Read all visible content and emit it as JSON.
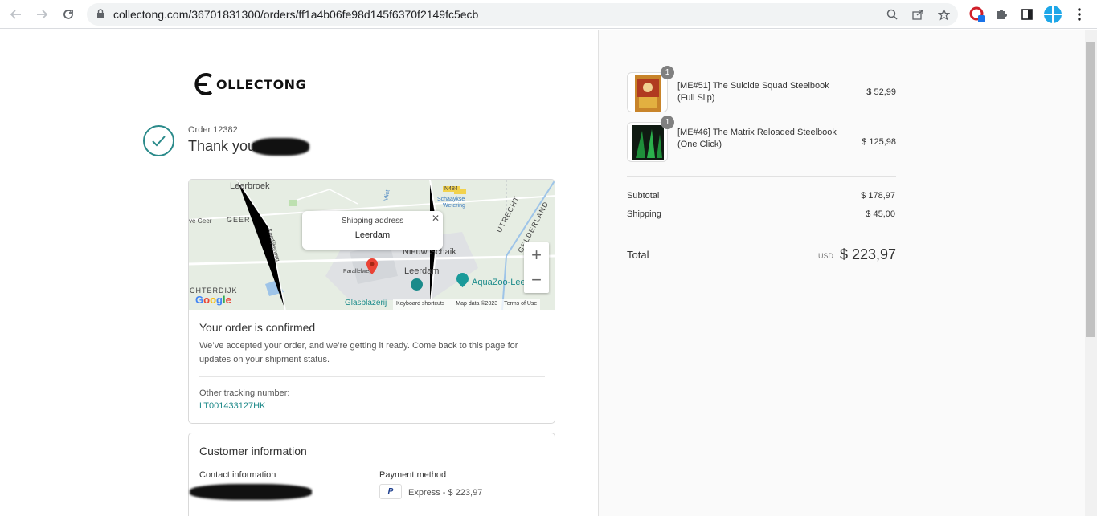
{
  "browser": {
    "url": "collectong.com/36701831300/orders/ff1a4b06fe98d145f6370f2149fc5ecb",
    "icons": [
      "back-icon",
      "forward-icon",
      "reload-icon",
      "lock-icon",
      "zoom-icon",
      "share-icon",
      "star-icon",
      "extension-icon",
      "puzzle-icon",
      "sidepanel-icon",
      "profile-icon",
      "menu-icon"
    ]
  },
  "store": {
    "logo_text": "OLLECTONG"
  },
  "order": {
    "number_label": "Order 12382",
    "thank_you": "Thank you"
  },
  "map": {
    "popup_title": "Shipping address",
    "popup_value": "Leerdam",
    "places": {
      "leerbroek": "Leerbroek",
      "geer": "GEER",
      "ve_geer": "ve Geer",
      "n484": "N484",
      "schaaykse": "Schaaykse",
      "wetering": "Wetering",
      "utrecht": "UTRECHT",
      "gelderland": "GELDERLAND",
      "nieuw_schaik": "Nieuw Schaik",
      "leerdam": "Leerdam",
      "aquazoo": "AquaZoo-Lee",
      "paralle": "Parallelweg",
      "chterdijk": "CHTERDIJK",
      "glasblazerij": "Glasblazerij",
      "koedijk": "Koedijkerweg",
      "vliet": "Vliet"
    },
    "footer": {
      "shortcuts": "Keyboard shortcuts",
      "mapdata": "Map data ©2023",
      "terms": "Terms of Use"
    },
    "google": "Google"
  },
  "confirmation": {
    "title": "Your order is confirmed",
    "text": "We’ve accepted your order, and we’re getting it ready. Come back to this page for updates on your shipment status.",
    "tracking_label": "Other tracking number:",
    "tracking_number": "LT001433127HK"
  },
  "customer": {
    "title": "Customer information",
    "contact_label": "Contact information",
    "payment_label": "Payment method",
    "payment_value": "Express - $ 223,97"
  },
  "summary": {
    "items": [
      {
        "quantity": "1",
        "name": "[ME#51] The Suicide Squad Steelbook (Full Slip)",
        "price": "$ 52,99"
      },
      {
        "quantity": "1",
        "name": "[ME#46] The Matrix Reloaded Steelbook (One Click)",
        "price": "$ 125,98"
      }
    ],
    "subtotal_label": "Subtotal",
    "subtotal": "$ 178,97",
    "shipping_label": "Shipping",
    "shipping": "$ 45,00",
    "total_label": "Total",
    "currency": "USD",
    "total": "$ 223,97"
  }
}
